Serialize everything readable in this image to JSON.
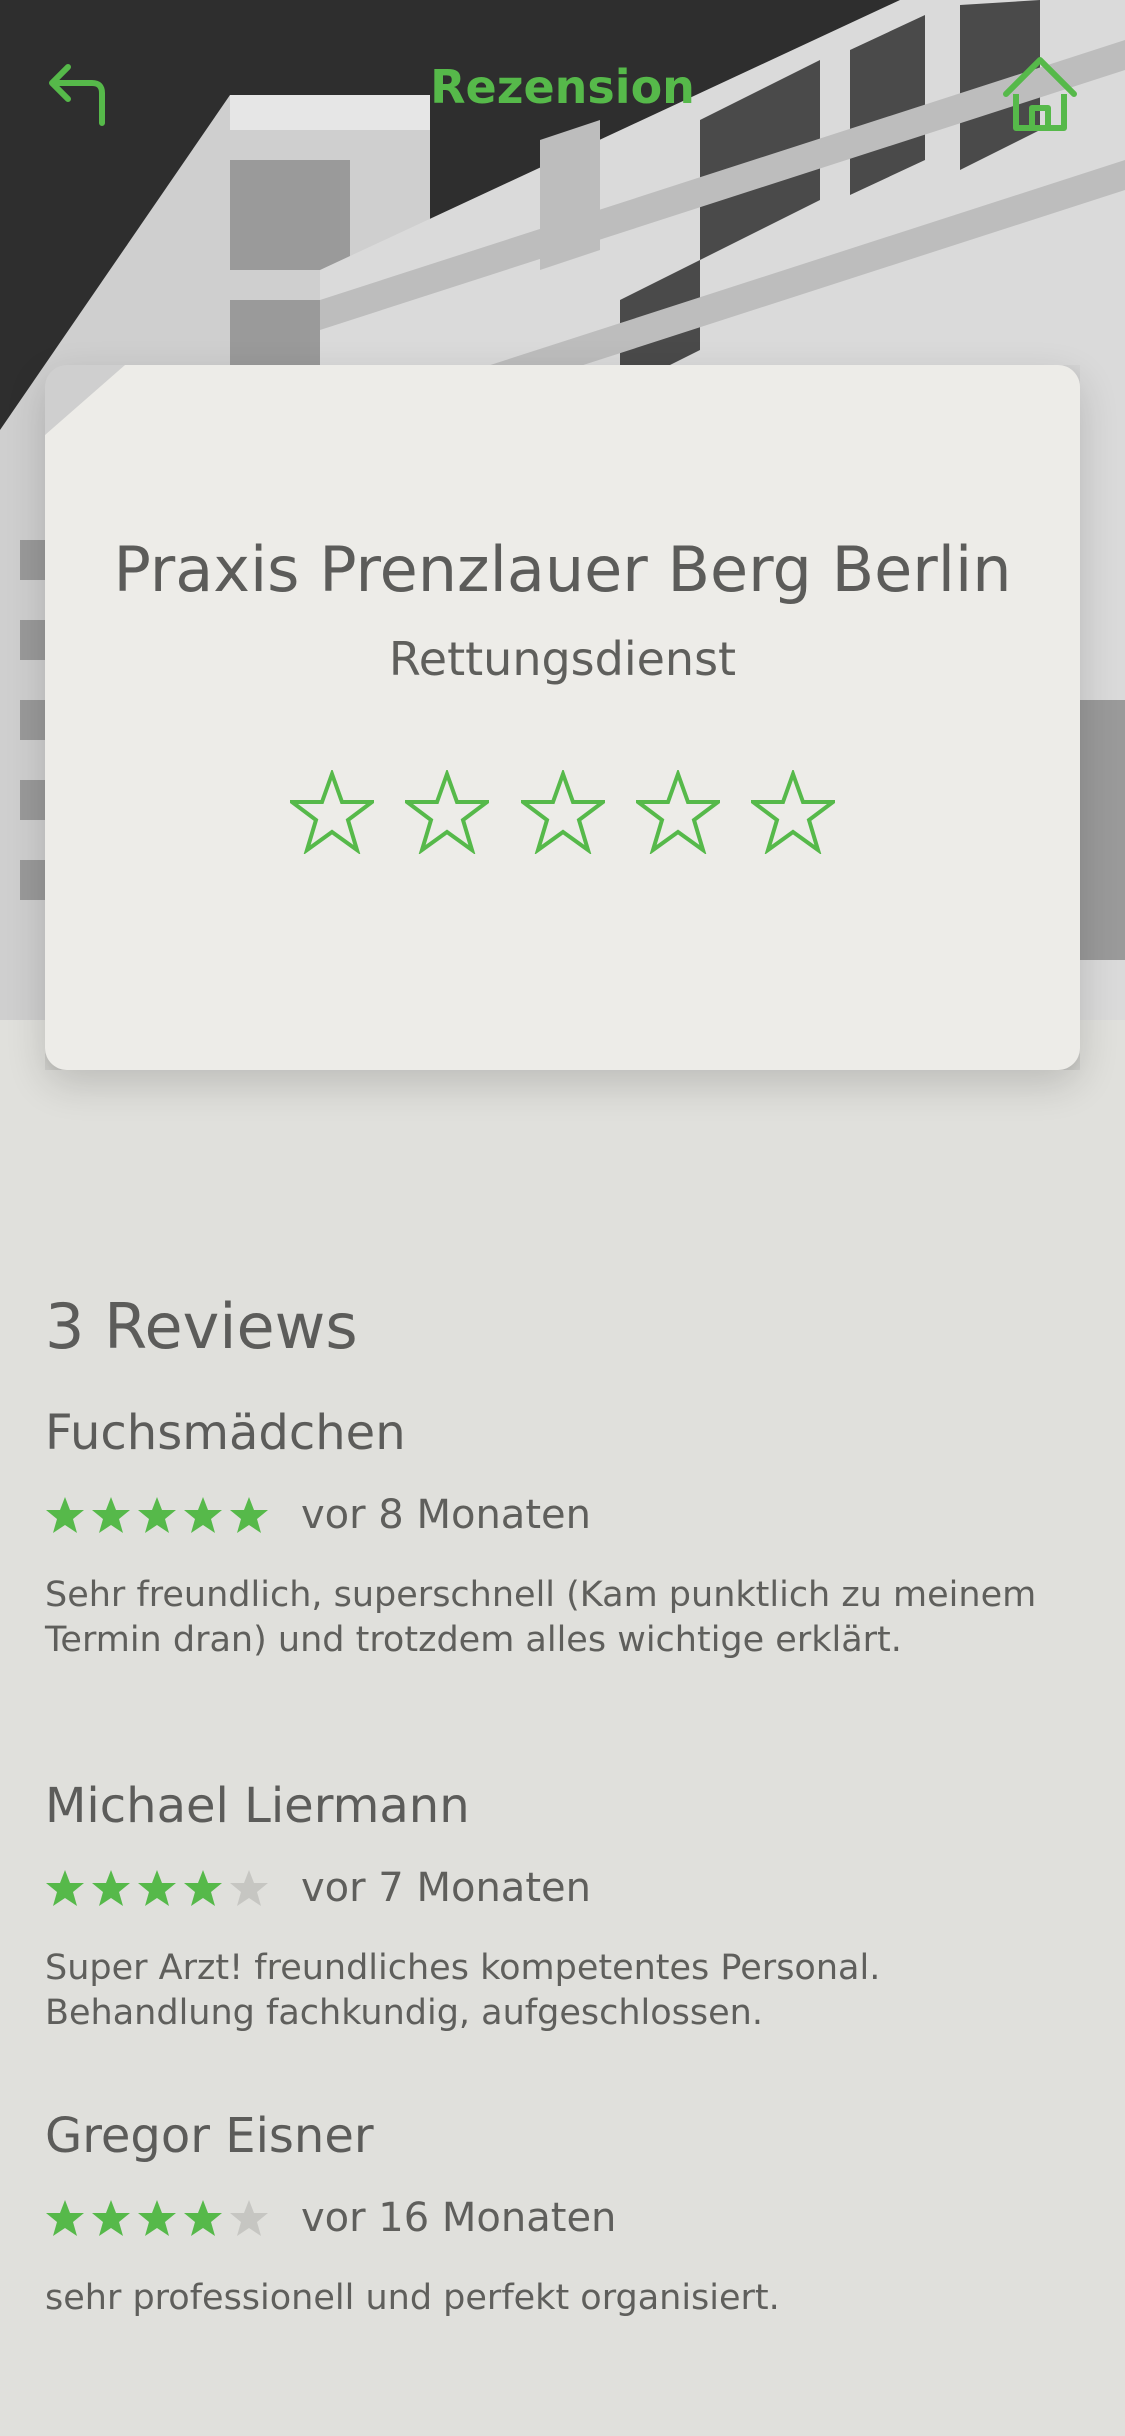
{
  "header": {
    "title": "Rezension",
    "back_icon": "back-arrow-icon",
    "home_icon": "home-icon"
  },
  "practice": {
    "name": "Praxis Prenzlauer Berg Berlin",
    "type": "Rettungsdienst",
    "rating_stars_total": 5,
    "rating_selected": 0
  },
  "reviews": {
    "heading": "3 Reviews",
    "items": [
      {
        "author": "Fuchsmädchen",
        "rating": 5,
        "time": "vor 8 Monaten",
        "text": "Sehr freundlich, superschnell (Kam punktlich zu meinem Termin dran) und trotzdem alles wichtige erklärt."
      },
      {
        "author": "Michael Liermann",
        "rating": 4,
        "time": "vor 7 Monaten",
        "text": "Super Arzt! freundliches kompetentes Personal. Behandlung fachkundig, aufgeschlossen."
      },
      {
        "author": "Gregor Eisner",
        "rating": 4,
        "time": "vor 16 Monaten",
        "text": "sehr professionell und perfekt organisiert."
      }
    ]
  },
  "colors": {
    "accent": "#56b94a",
    "star_empty": "#c6c6c2",
    "background": "#e0e0dc",
    "card": "#edece8",
    "text": "#5f5f5c"
  }
}
